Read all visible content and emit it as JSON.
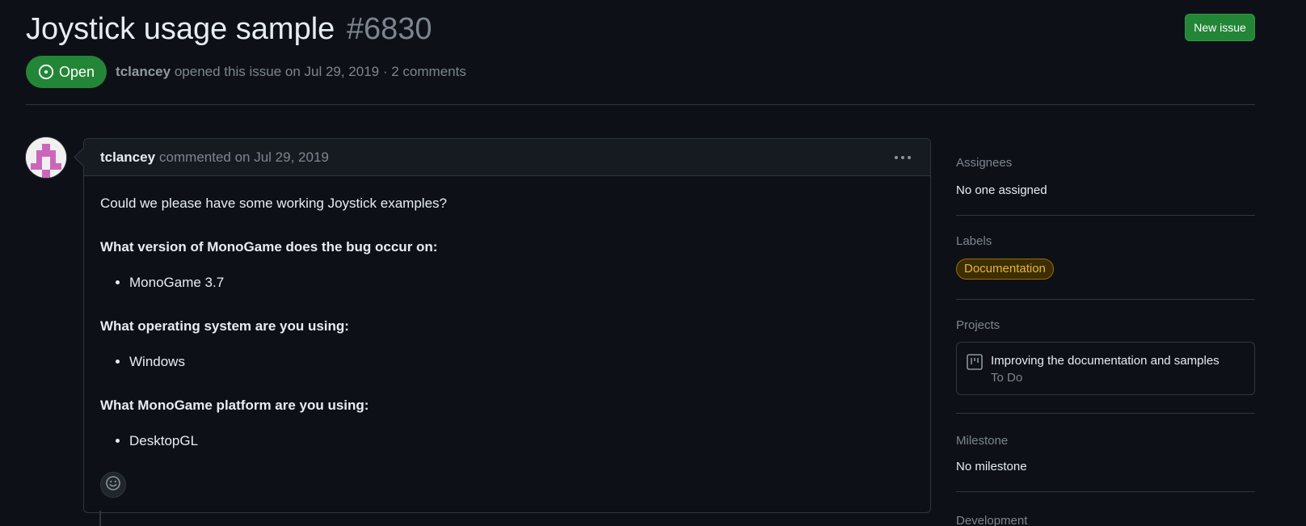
{
  "issue": {
    "title": "Joystick usage sample",
    "number": "#6830",
    "new_issue_label": "New issue",
    "state": "Open",
    "author": "tclancey",
    "opened_text": "opened this issue on Jul 29, 2019 · 2 comments"
  },
  "comment": {
    "author": "tclancey",
    "timestamp": "commented on Jul 29, 2019",
    "intro": "Could we please have some working Joystick examples?",
    "q1": "What version of MonoGame does the bug occur on:",
    "a1": "MonoGame 3.7",
    "q2": "What operating system are you using:",
    "a2": "Windows",
    "q3": "What MonoGame platform are you using:",
    "a3": "DesktopGL"
  },
  "sidebar": {
    "assignees_heading": "Assignees",
    "assignees_value": "No one assigned",
    "labels_heading": "Labels",
    "label": "Documentation",
    "projects_heading": "Projects",
    "project_name": "Improving the documentation and samples",
    "project_status": "To Do",
    "milestone_heading": "Milestone",
    "milestone_value": "No milestone",
    "development_heading": "Development"
  },
  "colors": {
    "background": "#0d1117",
    "accent_green": "#238636",
    "label_yellow": "#e3b341",
    "avatar_pink": "#cc66bb"
  },
  "icons": [
    "issue-open-icon",
    "kebab-menu-icon",
    "smiley-icon",
    "project-board-icon"
  ]
}
